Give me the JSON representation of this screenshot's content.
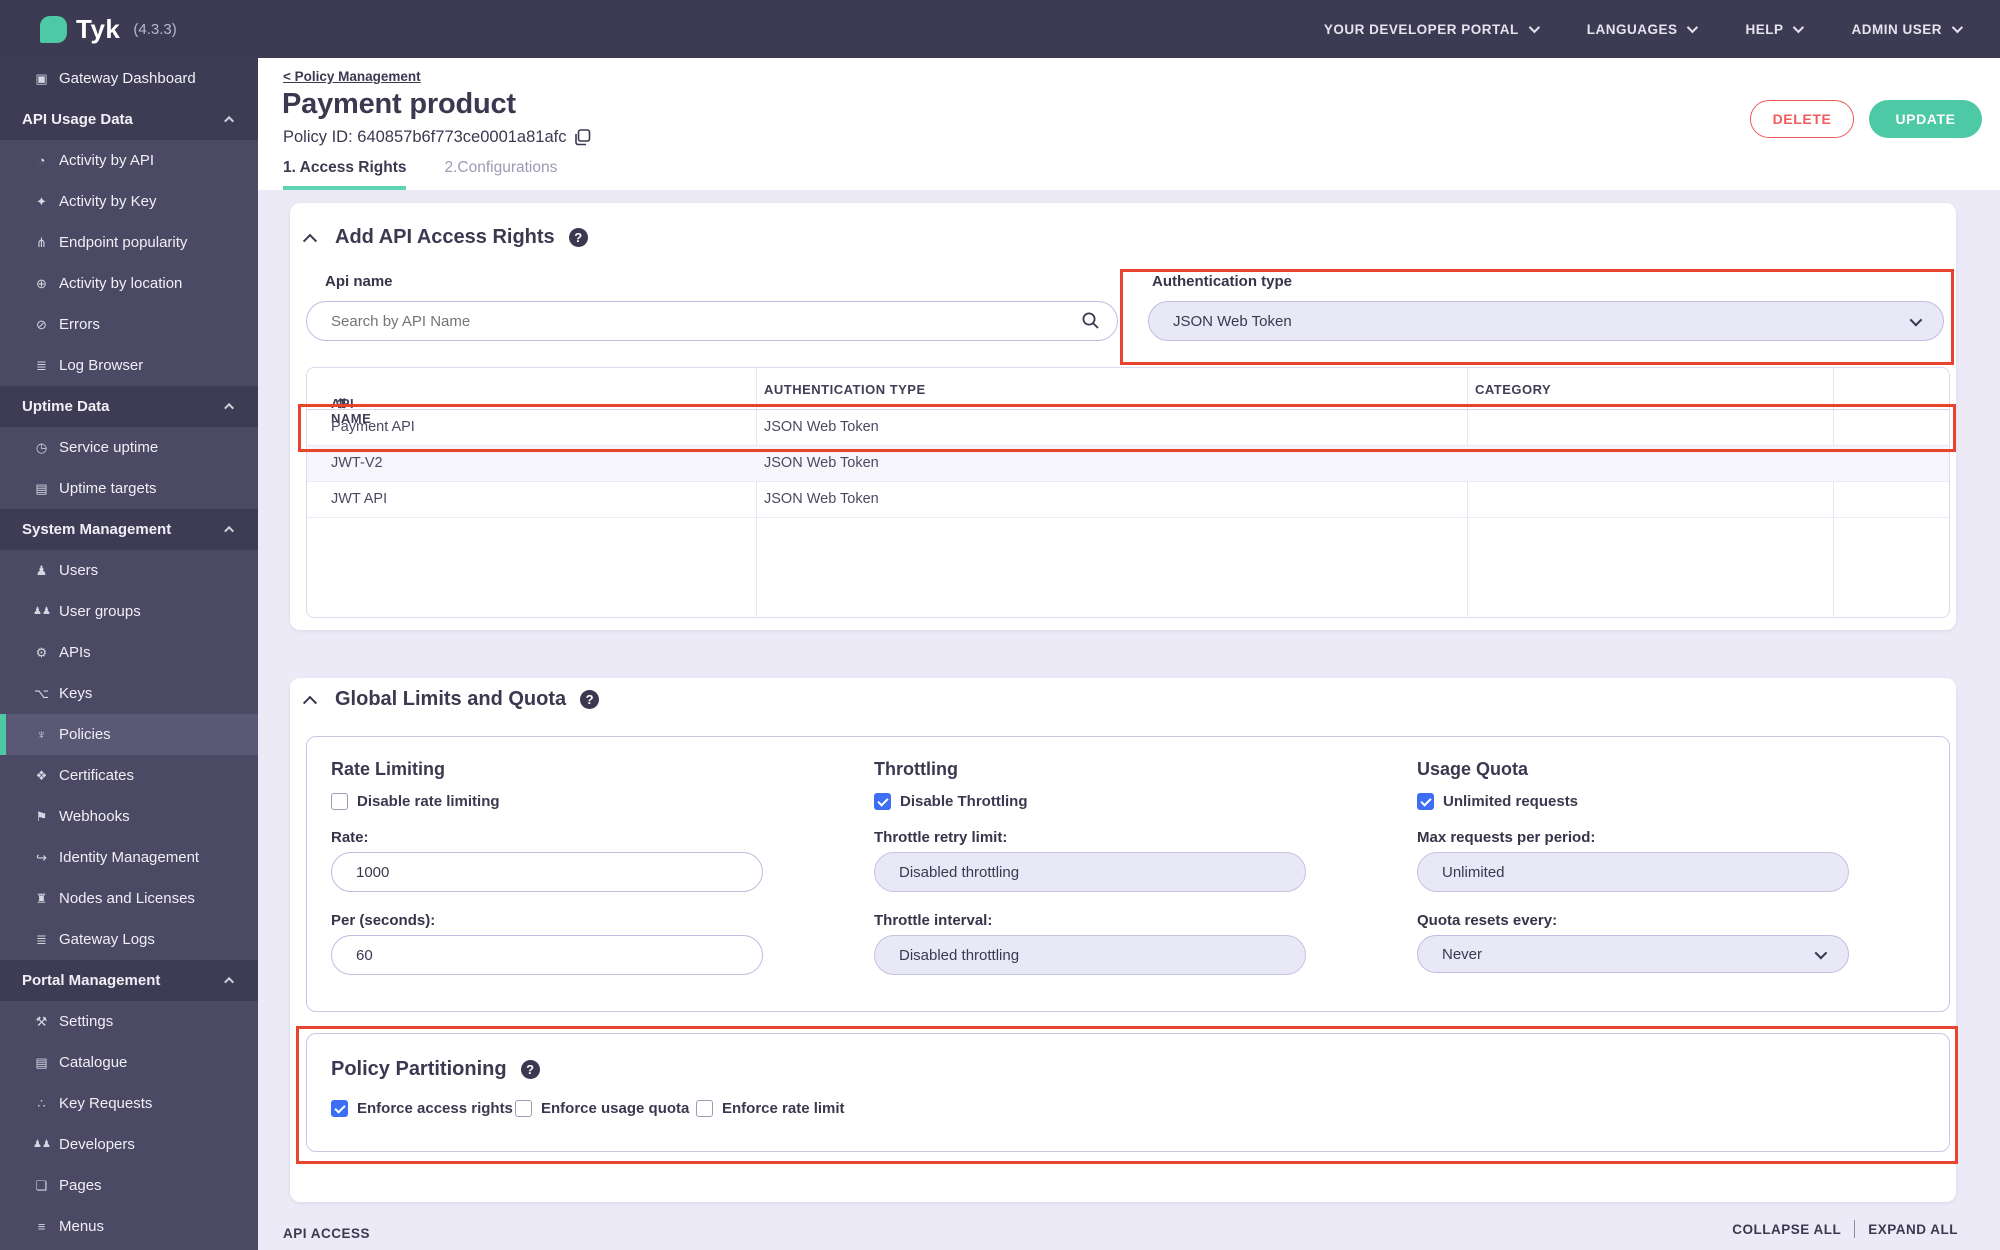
{
  "topbar": {
    "brand": "Tyk",
    "version": "(4.3.3)",
    "menus": [
      {
        "label": "YOUR DEVELOPER PORTAL"
      },
      {
        "label": "LANGUAGES"
      },
      {
        "label": "HELP"
      },
      {
        "label": "ADMIN USER"
      }
    ]
  },
  "sidebar": {
    "gateway_dashboard": {
      "glyph": "▣",
      "label": "Gateway Dashboard"
    },
    "sections": [
      {
        "label": "API Usage Data",
        "items": [
          {
            "glyph": "◔",
            "label": "Activity by API"
          },
          {
            "glyph": "✦",
            "label": "Activity by Key"
          },
          {
            "glyph": "⋔",
            "label": "Endpoint popularity"
          },
          {
            "glyph": "⊕",
            "label": "Activity by location"
          },
          {
            "glyph": "⊘",
            "label": "Errors"
          },
          {
            "glyph": "≣",
            "label": "Log Browser"
          }
        ]
      },
      {
        "label": "Uptime Data",
        "items": [
          {
            "glyph": "◷",
            "label": "Service uptime"
          },
          {
            "glyph": "▤",
            "label": "Uptime targets"
          }
        ]
      },
      {
        "label": "System Management",
        "items": [
          {
            "glyph": "♟",
            "label": "Users"
          },
          {
            "glyph": "♟♟",
            "label": "User groups"
          },
          {
            "glyph": "⚙",
            "label": "APIs"
          },
          {
            "glyph": "⌥",
            "label": "Keys"
          },
          {
            "glyph": "♆",
            "label": "Policies"
          },
          {
            "glyph": "❖",
            "label": "Certificates"
          },
          {
            "glyph": "⚑",
            "label": "Webhooks"
          },
          {
            "glyph": "↪",
            "label": "Identity Management"
          },
          {
            "glyph": "♜",
            "label": "Nodes and Licenses"
          },
          {
            "glyph": "≣",
            "label": "Gateway Logs"
          }
        ]
      },
      {
        "label": "Portal Management",
        "items": [
          {
            "glyph": "⚒",
            "label": "Settings"
          },
          {
            "glyph": "▤",
            "label": "Catalogue"
          },
          {
            "glyph": "∴",
            "label": "Key Requests"
          },
          {
            "glyph": "♟♟",
            "label": "Developers"
          },
          {
            "glyph": "❏",
            "label": "Pages"
          },
          {
            "glyph": "≡",
            "label": "Menus"
          }
        ]
      }
    ]
  },
  "header": {
    "breadcrumb": "< Policy Management",
    "title": "Payment product",
    "policy_id": "Policy ID: 640857b6f773ce0001a81afc",
    "tabs": [
      {
        "label": "1. Access Rights"
      },
      {
        "label": "2.Configurations"
      }
    ],
    "delete_label": "DELETE",
    "update_label": "UPDATE"
  },
  "access": {
    "title": "Add API Access Rights",
    "api_name_label": "Api name",
    "search_placeholder": "Search by API Name",
    "auth_label": "Authentication type",
    "auth_value": "JSON Web Token",
    "columns": [
      "API NAME",
      "AUTHENTICATION TYPE",
      "CATEGORY"
    ],
    "rows": [
      {
        "name": "Payment API",
        "auth": "JSON Web Token",
        "category": ""
      },
      {
        "name": "JWT-V2",
        "auth": "JSON Web Token",
        "category": ""
      },
      {
        "name": "JWT API",
        "auth": "JSON Web Token",
        "category": ""
      }
    ]
  },
  "limits": {
    "title": "Global Limits and Quota",
    "rate": {
      "title": "Rate Limiting",
      "toggle_label": "Disable rate limiting",
      "toggle_checked": false,
      "field1_label": "Rate:",
      "field1_value": "1000",
      "field2_label": "Per (seconds):",
      "field2_value": "60"
    },
    "throttle": {
      "title": "Throttling",
      "toggle_label": "Disable Throttling",
      "toggle_checked": true,
      "field1_label": "Throttle retry limit:",
      "field1_value": "Disabled throttling",
      "field2_label": "Throttle interval:",
      "field2_value": "Disabled throttling"
    },
    "quota": {
      "title": "Usage Quota",
      "toggle_label": "Unlimited requests",
      "toggle_checked": true,
      "field1_label": "Max requests per period:",
      "field1_value": "Unlimited",
      "field2_label": "Quota resets every:",
      "field2_value": "Never"
    }
  },
  "partitioning": {
    "title": "Policy Partitioning",
    "options": [
      {
        "label": "Enforce access rights",
        "checked": true
      },
      {
        "label": "Enforce usage quota",
        "checked": false
      },
      {
        "label": "Enforce rate limit",
        "checked": false
      }
    ]
  },
  "footer": {
    "section": "API ACCESS",
    "collapse": "COLLAPSE ALL",
    "expand": "EXPAND ALL"
  },
  "icons": {
    "help": "?",
    "sort": "⇅"
  },
  "colors": {
    "accent_teal": "#4dc9a5",
    "danger_red": "#f15b5b",
    "annotation_red": "#e8432c",
    "checkbox_blue": "#3d6ef5",
    "sidebar_bg": "#4b4963",
    "topbar_bg": "#3d3b54",
    "page_bg": "#ebeaf6"
  }
}
